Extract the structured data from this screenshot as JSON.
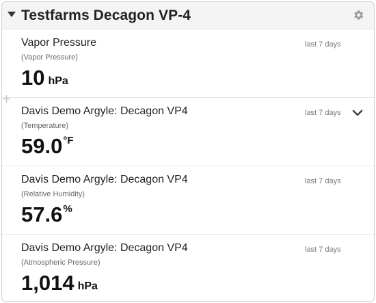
{
  "widget": {
    "title": "Testfarms Decagon VP-4",
    "icons": {
      "collapse": "caret-down-icon",
      "settings": "gear-icon"
    }
  },
  "cards": [
    {
      "sensor": "Vapor Pressure",
      "metric": "(Vapor Pressure)",
      "period": "last 7 days",
      "value": "10",
      "unit": "hPa"
    },
    {
      "sensor": "Davis Demo Argyle: Decagon VP4",
      "metric": "(Temperature)",
      "period": "last 7 days",
      "value": "59.0",
      "unit": "°F",
      "expand_icon": "chevron-down-icon"
    },
    {
      "sensor": "Davis Demo Argyle: Decagon VP4",
      "metric": "(Relative Humidity)",
      "period": "last 7 days",
      "value": "57.6",
      "unit": "%"
    },
    {
      "sensor": "Davis Demo Argyle: Decagon VP4",
      "metric": "(Atmospheric Pressure)",
      "period": "last 7 days",
      "value": "1,014",
      "unit": "hPa"
    }
  ]
}
